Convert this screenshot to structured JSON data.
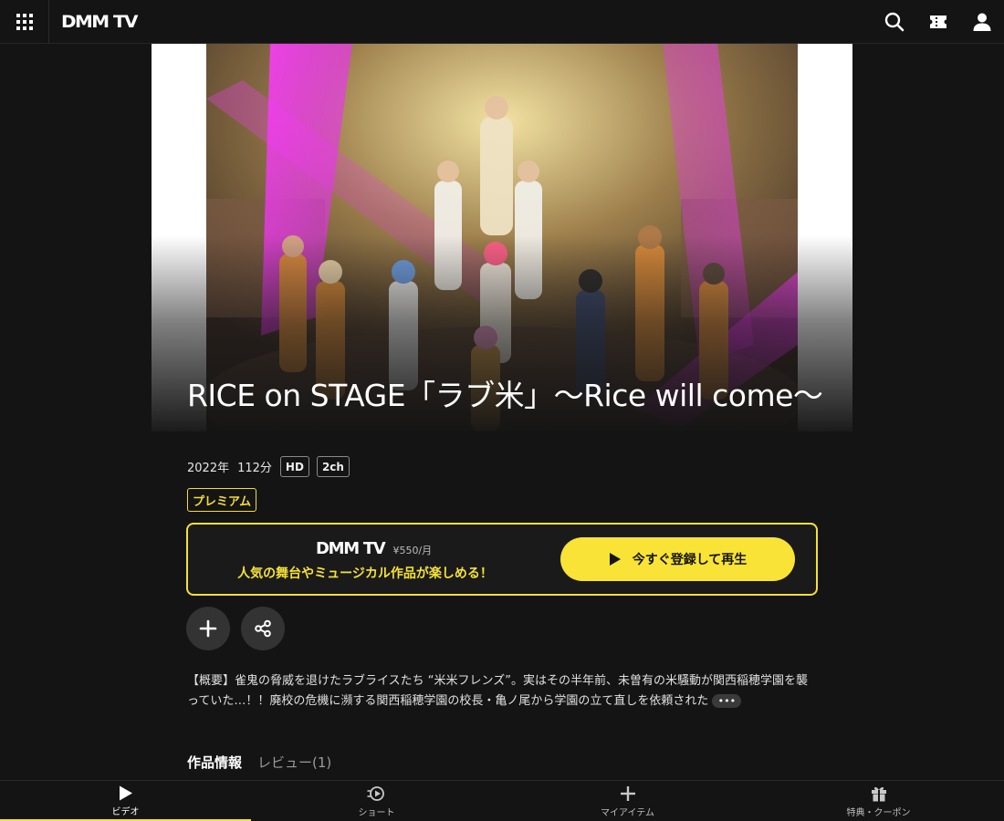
{
  "header": {
    "logo": "DMM TV",
    "icons": [
      "apps-grid-icon",
      "search-icon",
      "ticket-icon",
      "account-icon"
    ]
  },
  "work": {
    "title": "RICE on STAGE「ラブ米」～Rice will come～",
    "year": "2022年",
    "duration": "112分",
    "tags": [
      "HD",
      "2ch"
    ],
    "badge": "プレミアム"
  },
  "promo": {
    "logo": "DMM TV",
    "price": "¥550/月",
    "catch": "人気の舞台やミュージカル作品が楽しめる！",
    "cta_label": "今すぐ登録して再生"
  },
  "actions": {
    "add": "add-to-list-icon",
    "share": "share-icon"
  },
  "synopsis": {
    "text": "【概要】雀鬼の脅威を退けたラブライスたち “米米フレンズ”。実はその半年前、未曽有の米騒動が関西稲穂学園を襲っていた…！！廃校の危機に瀕する関西稲穂学園の校長・亀ノ尾から学園の立て直しを依頼された",
    "more": "•••"
  },
  "tabs": {
    "info": "作品情報",
    "reviews": "レビュー(1)"
  },
  "bottom_nav": [
    {
      "label": "ビデオ",
      "icon": "video-play-icon",
      "active": true
    },
    {
      "label": "ショート",
      "icon": "short-icon",
      "active": false
    },
    {
      "label": "マイアイテム",
      "icon": "plus-icon",
      "active": false
    },
    {
      "label": "特典・クーポン",
      "icon": "gift-icon",
      "active": false
    }
  ],
  "colors": {
    "background": "#141414",
    "accent": "#f4e13a",
    "cta": "#f9e336"
  }
}
